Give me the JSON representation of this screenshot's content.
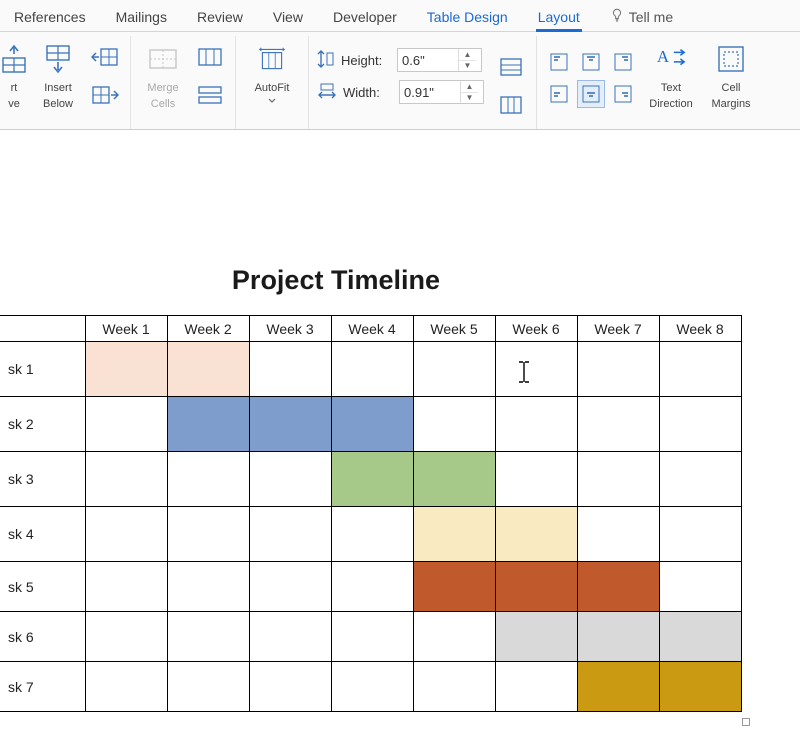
{
  "tabs": {
    "references": "References",
    "mailings": "Mailings",
    "review": "Review",
    "view": "View",
    "developer": "Developer",
    "table_design": "Table Design",
    "layout": "Layout",
    "tell_me": "Tell me"
  },
  "ribbon": {
    "insert_above_l1": "rt",
    "insert_above_l2": "ve",
    "insert_below_l1": "Insert",
    "insert_below_l2": "Below",
    "merge_l1": "Merge",
    "merge_l2": "Cells",
    "autofit": "AutoFit",
    "height_label": "Height:",
    "width_label": "Width:",
    "height_value": "0.6\"",
    "width_value": "0.91\"",
    "text_direction_l1": "Text",
    "text_direction_l2": "Direction",
    "cell_margins_l1": "Cell",
    "cell_margins_l2": "Margins"
  },
  "document": {
    "title": "Project Timeline",
    "weeks": [
      "Week 1",
      "Week 2",
      "Week 3",
      "Week 4",
      "Week 5",
      "Week 6",
      "Week 7",
      "Week 8"
    ],
    "tasks": [
      "sk 1",
      "sk 2",
      "sk 3",
      "sk 4",
      "sk 5",
      "sk 6",
      "sk 7"
    ],
    "colors": {
      "task1": "#f9e1d4",
      "task2": "#7e9dcc",
      "task3": "#a6c98a",
      "task4": "#f9eac1",
      "task5": "#c0592b",
      "task6": "#d9d9d9",
      "task7": "#ca9a12"
    }
  },
  "chart_data": {
    "type": "bar",
    "title": "Project Timeline",
    "xlabel": "",
    "ylabel": "",
    "categories": [
      "Week 1",
      "Week 2",
      "Week 3",
      "Week 4",
      "Week 5",
      "Week 6",
      "Week 7",
      "Week 8"
    ],
    "series": [
      {
        "name": "sk 1",
        "start": 1,
        "end": 2,
        "color": "#f9e1d4"
      },
      {
        "name": "sk 2",
        "start": 2,
        "end": 4,
        "color": "#7e9dcc"
      },
      {
        "name": "sk 3",
        "start": 4,
        "end": 5,
        "color": "#a6c98a"
      },
      {
        "name": "sk 4",
        "start": 5,
        "end": 6,
        "color": "#f9eac1"
      },
      {
        "name": "sk 5",
        "start": 5,
        "end": 7,
        "color": "#c0592b"
      },
      {
        "name": "sk 6",
        "start": 6,
        "end": 8,
        "color": "#d9d9d9"
      },
      {
        "name": "sk 7",
        "start": 7,
        "end": 8,
        "color": "#ca9a12"
      }
    ],
    "xlim": [
      1,
      8
    ]
  }
}
